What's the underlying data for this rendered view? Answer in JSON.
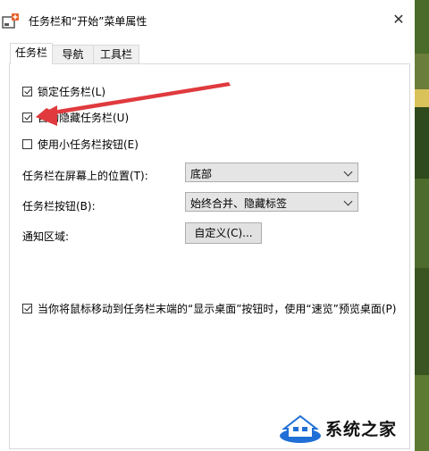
{
  "window": {
    "title": "任务栏和“开始”菜单属性",
    "close_glyph": "✕"
  },
  "tabs": [
    {
      "label": "任务栏",
      "active": true
    },
    {
      "label": "导航",
      "active": false
    },
    {
      "label": "工具栏",
      "active": false
    }
  ],
  "options": {
    "lock_taskbar": {
      "label": "锁定任务栏(L)",
      "checked": true
    },
    "auto_hide": {
      "label": "自动隐藏任务栏(U)",
      "checked": true
    },
    "small_buttons": {
      "label": "使用小任务栏按钮(E)",
      "checked": false
    },
    "peek": {
      "label": "当你将鼠标移动到任务栏末端的“显示桌面”按钮时，使用“速览”预览桌面(P)",
      "checked": true
    }
  },
  "position": {
    "label": "任务栏在屏幕上的位置(T):",
    "value": "底部"
  },
  "buttons_setting": {
    "label": "任务栏按钮(B):",
    "value": "始终合并、隐藏标签"
  },
  "notification": {
    "label": "通知区域:",
    "button": "自定义(C)..."
  },
  "watermark": {
    "text": "系统之家"
  },
  "colors": {
    "arrow": "#e03a3e",
    "tab_border": "#d9d9d9",
    "select_bg": "#e5e5e5"
  }
}
